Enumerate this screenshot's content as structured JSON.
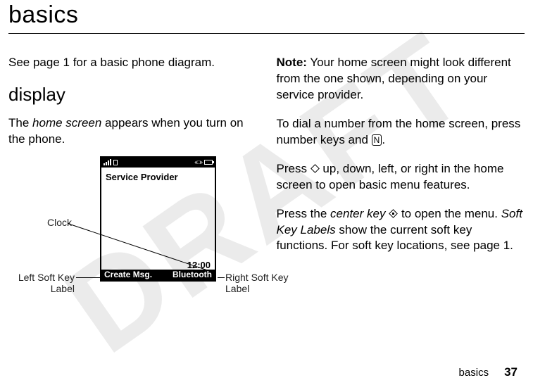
{
  "watermark": "DRAFT",
  "title": "basics",
  "left": {
    "p1": "See page 1 for a basic phone diagram.",
    "h2": "display",
    "p2a": "The ",
    "p2_ital": "home screen",
    "p2b": " appears when you turn on the phone."
  },
  "phone": {
    "provider": "Service Provider",
    "clock": "12:00",
    "soft_left": "Create Msg.",
    "soft_right": "Bluetooth"
  },
  "callouts": {
    "clock": "Clock",
    "left1": "Left Soft Key",
    "left2": "Label",
    "right1": "Right Soft Key",
    "right2": "Label"
  },
  "right": {
    "p1a": "Note:",
    "p1b": " Your home screen might look different from the one shown, depending on your service provider.",
    "p2a": "To dial a number from the home screen, press number keys and ",
    "p2_key": "N",
    "p2b": ".",
    "p3a": "Press ",
    "p3b": " up, down, left, or right in the home screen to open basic menu features.",
    "p4a": "Press the ",
    "p4_ital1": "center key",
    "p4b": " ",
    "p4c": " to open the menu. ",
    "p4_ital2": "Soft Key Labels",
    "p4d": " show the current soft key functions. For soft key locations, see page 1."
  },
  "footer": {
    "section": "basics",
    "page": "37"
  }
}
